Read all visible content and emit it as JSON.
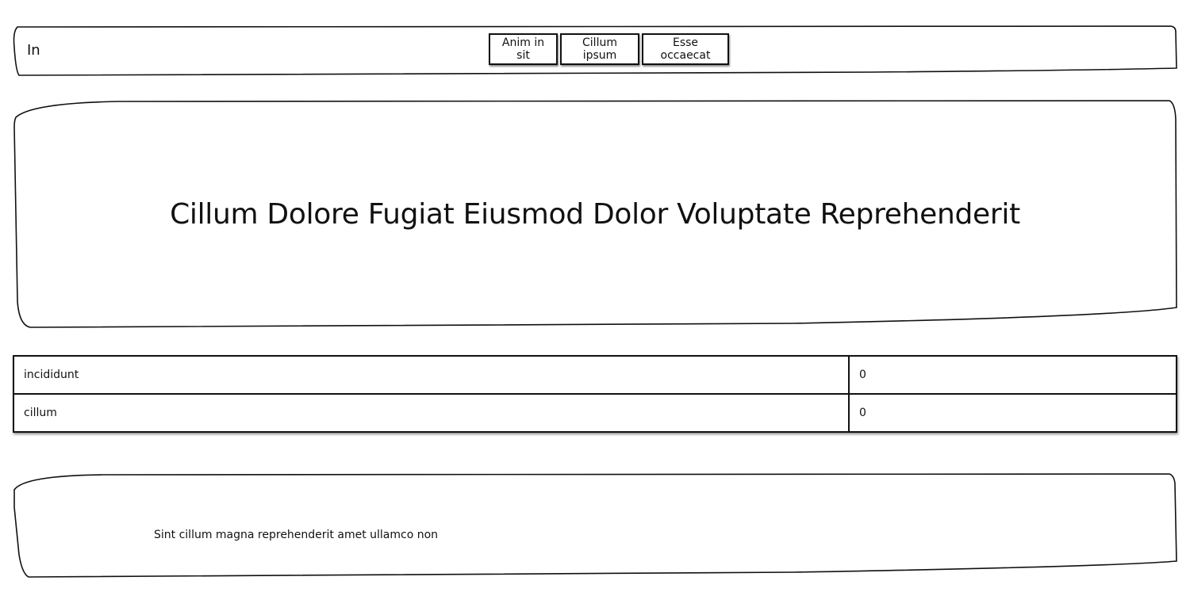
{
  "header": {
    "brand": "In",
    "nav": [
      {
        "label": "Anim in sit"
      },
      {
        "label": "Cillum ipsum"
      },
      {
        "label": "Esse occaecat"
      }
    ]
  },
  "hero": {
    "title": "Cillum Dolore Fugiat Eiusmod Dolor Voluptate Reprehenderit"
  },
  "table": {
    "rows": [
      {
        "label": "incididunt",
        "value": "0"
      },
      {
        "label": "cillum",
        "value": "0"
      }
    ]
  },
  "footer": {
    "text": "Sint cillum magna reprehenderit amet ullamco non"
  }
}
